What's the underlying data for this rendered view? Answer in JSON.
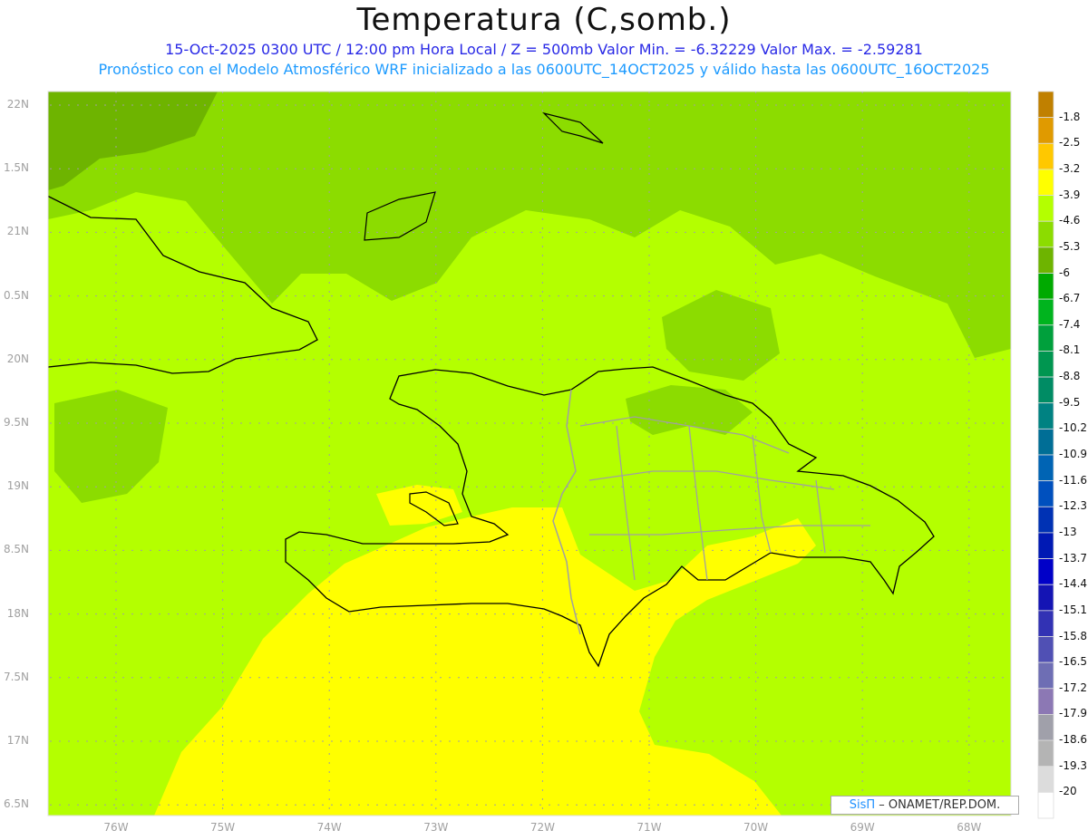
{
  "header": {
    "title": "Temperatura (C,somb.)",
    "line1": "15-Oct-2025  0300 UTC / 12:00 pm Hora Local / Z = 500mb  Valor Min. = -6.32229  Valor Max. = -2.59281",
    "line2": "Pronóstico con el Modelo Atmosférico WRF inicializado a las 0600UTC_14OCT2025 y válido hasta las  0600UTC_16OCT2025"
  },
  "axes": {
    "lat_labels": [
      "22N",
      "1.5N",
      "21N",
      "0.5N",
      "20N",
      "9.5N",
      "19N",
      "8.5N",
      "18N",
      "7.5N",
      "17N",
      "6.5N"
    ],
    "lon_labels": [
      "76W",
      "75W",
      "74W",
      "73W",
      "72W",
      "71W",
      "70W",
      "69W",
      "68W"
    ]
  },
  "colorbar": {
    "labels": [
      "-1.8",
      "-2.5",
      "-3.2",
      "-3.9",
      "-4.6",
      "-5.3",
      "-6",
      "-6.7",
      "-7.4",
      "-8.1",
      "-8.8",
      "-9.5",
      "-10.2",
      "-10.9",
      "-11.6",
      "-12.3",
      "-13",
      "-13.7",
      "-14.4",
      "-15.1",
      "-15.8",
      "-16.5",
      "-17.2",
      "-17.9",
      "-18.6",
      "-19.3",
      "-20"
    ],
    "colors": [
      "#c08000",
      "#e09a00",
      "#ffc800",
      "#ffff00",
      "#b4ff00",
      "#8cdc00",
      "#6eb400",
      "#00aa00",
      "#00b41e",
      "#00a03c",
      "#009650",
      "#008c64",
      "#008282",
      "#006e96",
      "#0064b4",
      "#0050be",
      "#0032b4",
      "#0019b4",
      "#0000c8",
      "#1414b4",
      "#3232b4",
      "#5050b4",
      "#6e6eb4",
      "#8c78b4",
      "#a0a0aa",
      "#b4b4b4",
      "#dcdcdc",
      "#ffffff"
    ]
  },
  "map_colors": {
    "base": "#b4ff00",
    "cooler": "#8cdc00",
    "coolest": "#6eb400",
    "warmer": "#ffff00",
    "coastline": "#000000",
    "borders": "#a0a0a0"
  },
  "credit": {
    "brand": "SisΠ",
    "text": "– ONAMET/REP.DOM."
  }
}
